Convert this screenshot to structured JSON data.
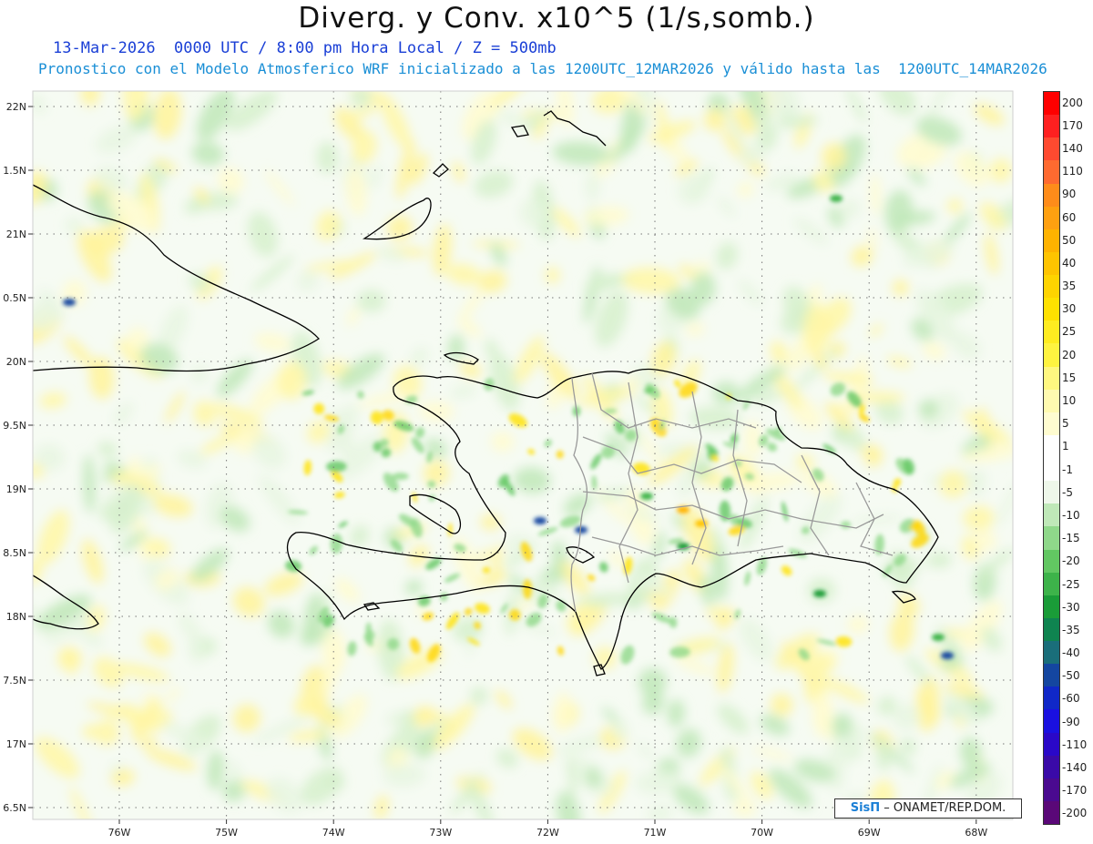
{
  "header": {
    "title": "Diverg. y Conv. x10^5 (1/s,somb.)",
    "line1": "13-Mar-2026  0000 UTC / 8:00 pm Hora Local / Z = 500mb",
    "line2": "Pronostico con el Modelo Atmosferico WRF inicializado a las 1200UTC_12MAR2026 y válido hasta las  1200UTC_14MAR2026"
  },
  "axes": {
    "lat_labels": [
      "22N",
      "1.5N",
      "21N",
      "0.5N",
      "20N",
      "9.5N",
      "19N",
      "8.5N",
      "18N",
      "7.5N",
      "17N",
      "6.5N"
    ],
    "lon_labels": [
      "76W",
      "75W",
      "74W",
      "73W",
      "72W",
      "71W",
      "70W",
      "69W",
      "68W"
    ]
  },
  "colorbar": {
    "labels": [
      "200",
      "170",
      "140",
      "110",
      "90",
      "60",
      "50",
      "40",
      "35",
      "30",
      "25",
      "20",
      "15",
      "10",
      "5",
      "1",
      "-1",
      "-5",
      "-10",
      "-15",
      "-20",
      "-25",
      "-30",
      "-35",
      "-40",
      "-50",
      "-60",
      "-90",
      "-110",
      "-140",
      "-170",
      "-200"
    ],
    "colors": [
      "#ff0000",
      "#ff2020",
      "#ff4a30",
      "#ff6a30",
      "#ff8c1a",
      "#ffa010",
      "#ffb300",
      "#ffc400",
      "#ffd400",
      "#ffe100",
      "#ffec20",
      "#fff340",
      "#fff780",
      "#fffab0",
      "#fffcd0",
      "#ffffff",
      "#ffffff",
      "#eef7ea",
      "#bfe8b8",
      "#8fd88a",
      "#62c762",
      "#3db34a",
      "#1a9c38",
      "#0f8450",
      "#1a6e7a",
      "#1446a0",
      "#1028c8",
      "#1a10e0",
      "#2a08c8",
      "#3a0aa8",
      "#4a0a90",
      "#5a0878"
    ]
  },
  "credit": {
    "brand": "SisΠ",
    "text": " – ONAMET/REP.DOM."
  },
  "icons": {
    "brand_symbol": "pi-logo-icon"
  }
}
